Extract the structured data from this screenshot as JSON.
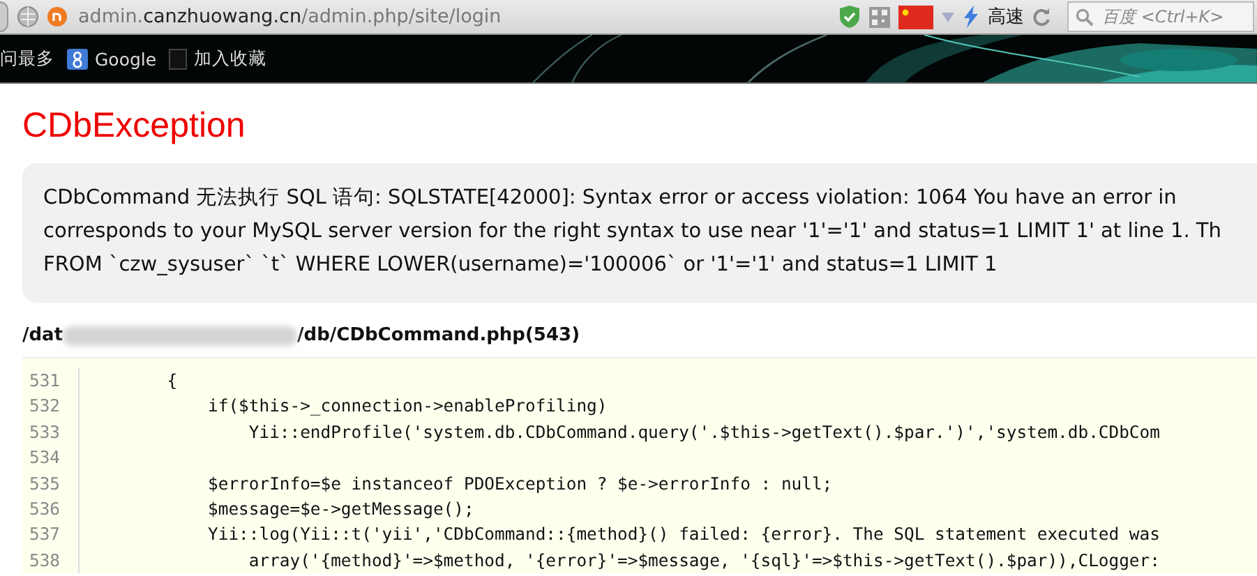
{
  "address_bar": {
    "url": "admin.**canzhuowang.cn**/admin.php/site/login",
    "speed_label": "高速",
    "search": {
      "placeholder": "百度 <Ctrl+K>"
    }
  },
  "bookmarks": [
    {
      "label": "问最多",
      "kind": "text"
    },
    {
      "label": "Google",
      "kind": "google"
    },
    {
      "label": "加入收藏",
      "kind": "box"
    }
  ],
  "page": {
    "title": "CDbException",
    "message_lines": [
      "CDbCommand 无法执行 SQL 语句: SQLSTATE[42000]: Syntax error or access violation: 1064 You have an error in",
      "corresponds to your MySQL server version for the right syntax to use near '1'='1' and status=1 LIMIT 1' at line 1. Th",
      "FROM `czw_sysuser` `t` WHERE LOWER(username)='100006` or '1'='1' and status=1 LIMIT 1"
    ],
    "file_path": {
      "start": "/dat",
      "end": "/db/CDbCommand.php(543)"
    },
    "code": [
      {
        "line": "531",
        "text": "        {"
      },
      {
        "line": "532",
        "text": "            if($this->_connection->enableProfiling)"
      },
      {
        "line": "533",
        "text": "                Yii::endProfile('system.db.CDbCommand.query('.$this->getText().$par.')','system.db.CDbCom"
      },
      {
        "line": "534"
      },
      {
        "line": "535",
        "text": "            $errorInfo=$e instanceof PDOException ? $e->errorInfo : null;"
      },
      {
        "line": "536",
        "text": "            $message=$e->getMessage();"
      },
      {
        "line": "537",
        "text": "            Yii::log(Yii::t('yii','CDbCommand::{method}() failed: {error}. The SQL statement executed was"
      },
      {
        "line": "538",
        "text": "                array('{method}'=>$method, '{error}'=>$message, '{sql}'=>$this->getText().$par)),CLogger:"
      }
    ]
  }
}
